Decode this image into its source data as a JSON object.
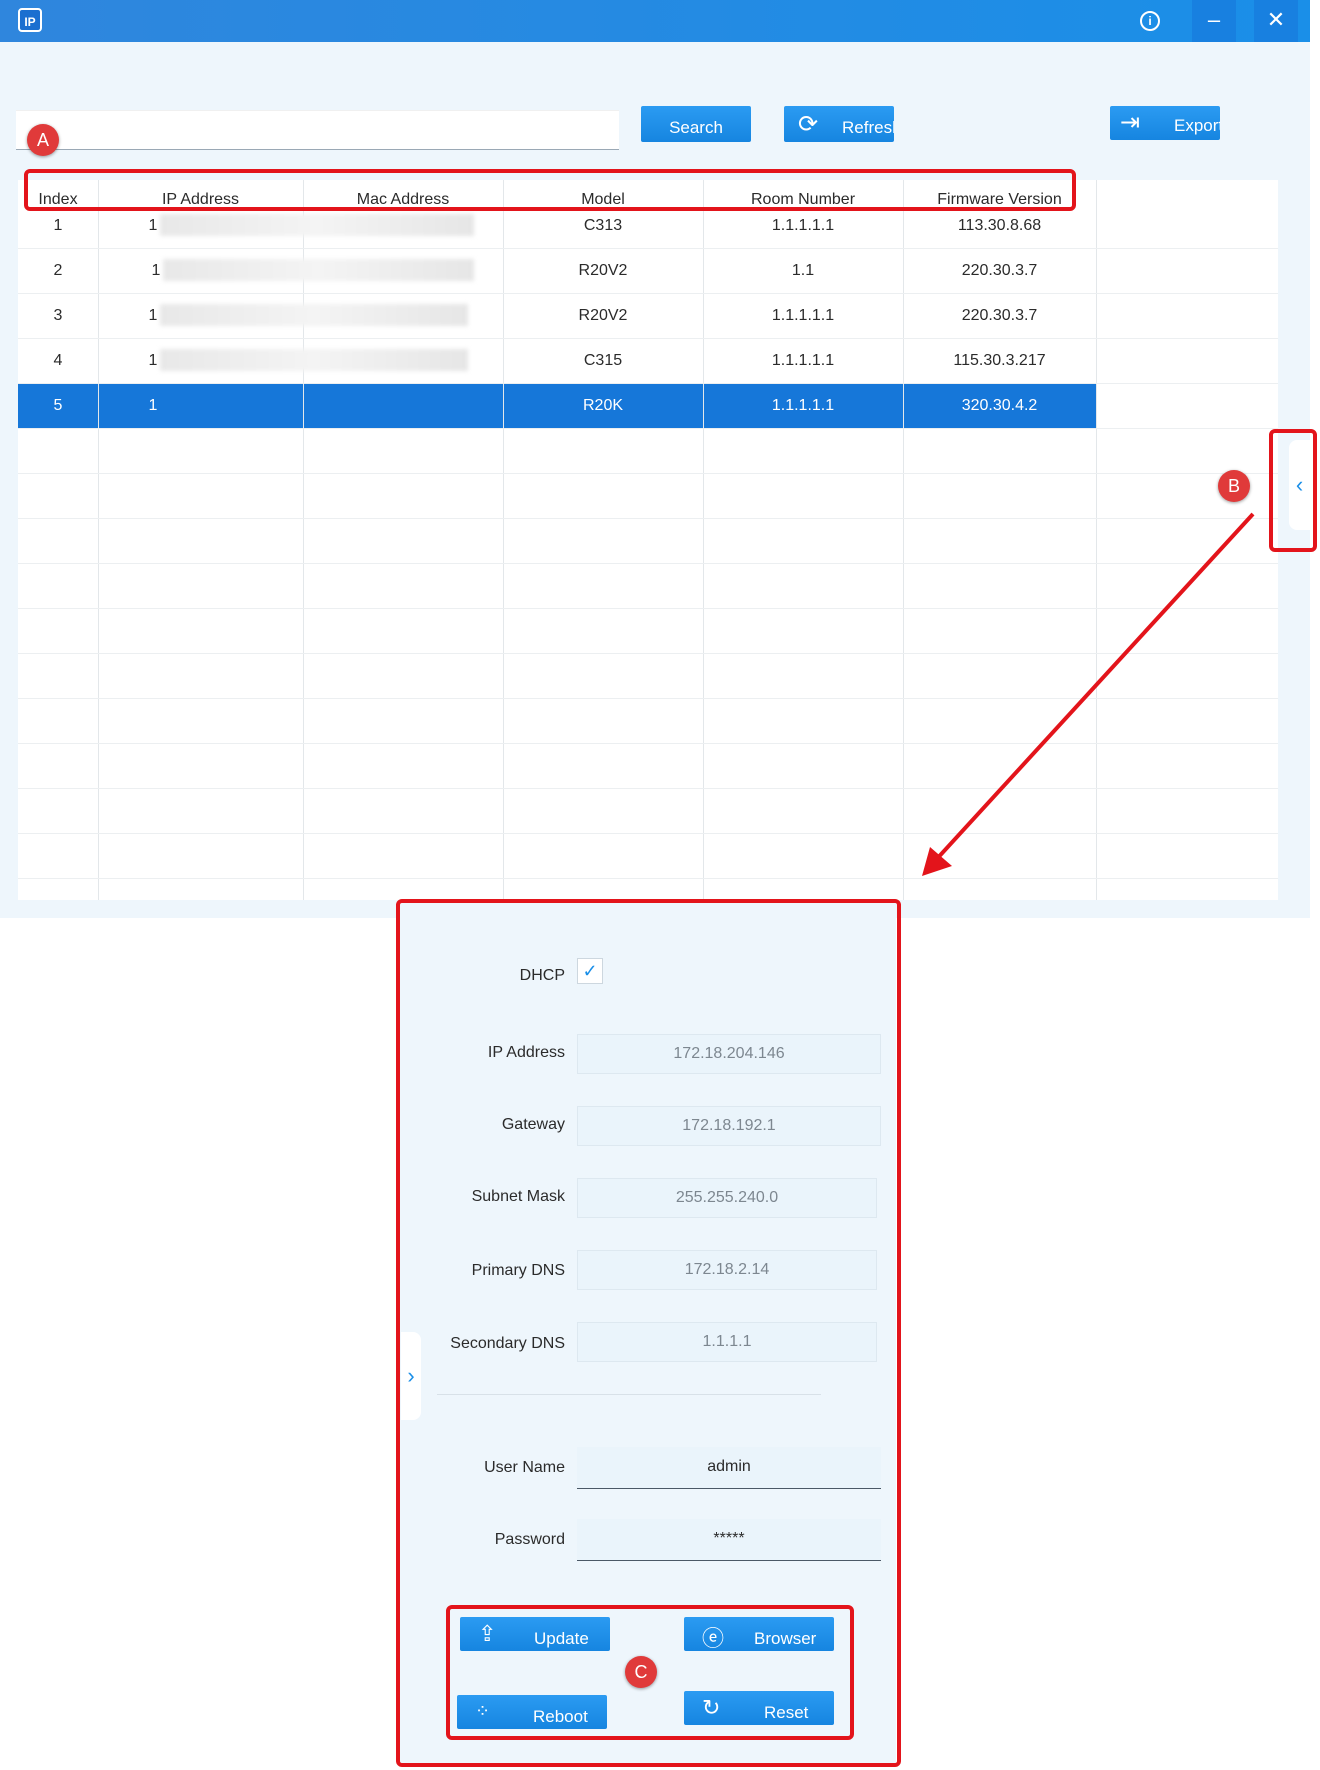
{
  "window": {
    "app_icon_text": "IP",
    "info_glyph": "i",
    "minimize_glyph": "–",
    "close_glyph": "✕"
  },
  "toolbar": {
    "search_placeholder": "",
    "search_label": "Search",
    "refresh_label": "Refresh",
    "export_label": "Export"
  },
  "table": {
    "headers": [
      "Index",
      "IP Address",
      "Mac Address",
      "Model",
      "Room Number",
      "Firmware Version"
    ],
    "rows": [
      {
        "index": "1",
        "ip": "1",
        "mac": "",
        "model": "C313",
        "room": "1.1.1.1.1",
        "firmware": "113.30.8.68"
      },
      {
        "index": "2",
        "ip": "1",
        "mac": "",
        "model": "R20V2",
        "room": "1.1",
        "firmware": "220.30.3.7"
      },
      {
        "index": "3",
        "ip": "1",
        "mac": "",
        "model": "R20V2",
        "room": "1.1.1.1.1",
        "firmware": "220.30.3.7"
      },
      {
        "index": "4",
        "ip": "1",
        "mac": "",
        "model": "C315",
        "room": "1.1.1.1.1",
        "firmware": "115.30.3.217"
      },
      {
        "index": "5",
        "ip": "1",
        "mac": "",
        "model": "R20K",
        "room": "1.1.1.1.1",
        "firmware": "320.30.4.2",
        "selected": true
      }
    ]
  },
  "panel": {
    "dhcp_label": "DHCP",
    "dhcp_checked": true,
    "ip_label": "IP Address",
    "ip_value": "172.18.204.146",
    "gateway_label": "Gateway",
    "gateway_value": "172.18.192.1",
    "subnet_label": "Subnet Mask",
    "subnet_value": "255.255.240.0",
    "pdns_label": "Primary DNS",
    "pdns_value": "172.18.2.14",
    "sdns_label": "Secondary DNS",
    "sdns_value": "1.1.1.1",
    "username_label": "User Name",
    "username_value": "admin",
    "password_label": "Password",
    "password_value": "*****",
    "update_label": "Update",
    "browser_label": "Browser",
    "reboot_label": "Reboot",
    "reset_label": "Reset"
  },
  "annotations": {
    "a": "A",
    "b": "B",
    "c": "C",
    "color": "#e3141b"
  },
  "icons": {
    "collapse_right": "chevron-left-icon",
    "collapse_left": "chevron-right-icon",
    "refresh": "refresh-icon",
    "export": "export-icon",
    "update": "upload-icon",
    "browser": "browser-icon",
    "reboot": "spinner-icon",
    "reset": "reset-icon"
  }
}
